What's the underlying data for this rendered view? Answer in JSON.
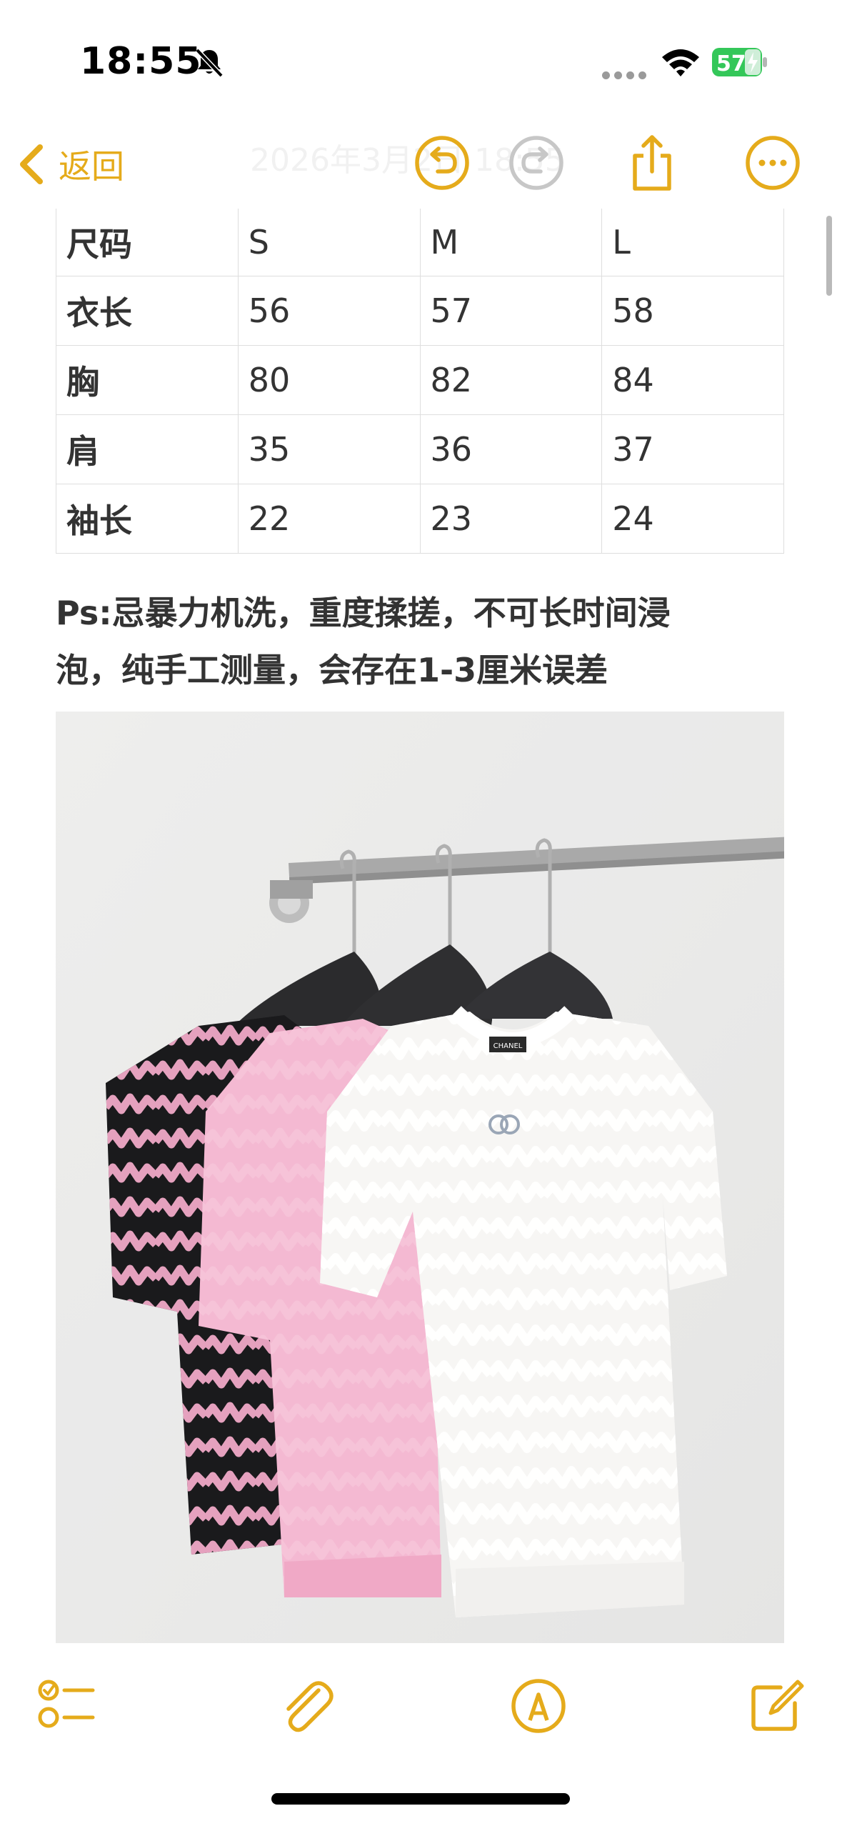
{
  "status_bar": {
    "time": "18:55",
    "battery_level": "57"
  },
  "nav": {
    "back_label": "返回",
    "date_text": "2026年3月2日 18:55"
  },
  "size_table": {
    "rows": [
      [
        "尺码",
        "S",
        "M",
        "L"
      ],
      [
        "衣长",
        "56",
        "57",
        "58"
      ],
      [
        "胸",
        "80",
        "82",
        "84"
      ],
      [
        "肩",
        "35",
        "36",
        "37"
      ],
      [
        "袖长",
        "22",
        "23",
        "24"
      ]
    ]
  },
  "note": {
    "line1": "Ps:忌暴力机洗，重度揉搓，不可长时间浸",
    "line2": "泡，纯手工测量，会存在1-3厘米误差"
  },
  "photo": {
    "tag_text": "CHANEL"
  },
  "icons": {
    "status": [
      "bell-slash-icon",
      "cellular-dots-icon",
      "wifi-icon",
      "battery-icon"
    ],
    "nav": [
      "back-chevron-icon",
      "undo-icon",
      "redo-icon",
      "share-icon",
      "more-icon"
    ],
    "toolbar": [
      "checklist-icon",
      "attachment-icon",
      "markup-icon",
      "compose-icon"
    ]
  },
  "colors": {
    "accent": "#E5AB1B",
    "battery": "#34C759",
    "text": "#333333",
    "table_border": "#DEDEDE"
  }
}
